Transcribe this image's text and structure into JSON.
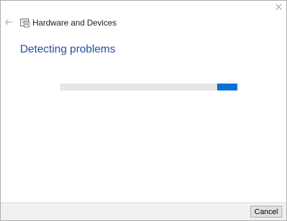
{
  "window": {
    "close_icon": "close-icon",
    "back_icon": "back-arrow-icon",
    "app_icon": "troubleshooter-icon",
    "app_title": "Hardware and Devices"
  },
  "main": {
    "heading": "Detecting problems",
    "progress": {
      "state": "indeterminate",
      "accent_color": "#0a6fd6",
      "track_color": "#e6e6e6"
    }
  },
  "footer": {
    "cancel_label": "Cancel"
  },
  "colors": {
    "heading": "#1f4e9c",
    "footer_bg": "#f0f0f0"
  }
}
